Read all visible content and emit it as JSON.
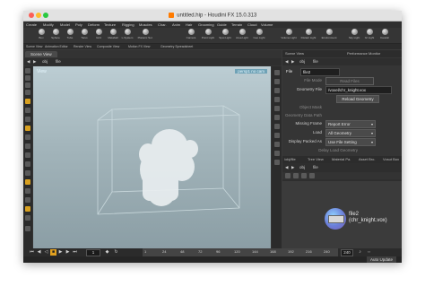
{
  "window": {
    "title": "untitled.hip - Houdini FX 15.0.313"
  },
  "menu": [
    "Create",
    "Modify",
    "Model",
    "Poly",
    "Deform",
    "Texture",
    "Rigging",
    "Muscles",
    "Char.",
    "Anim",
    "Hair",
    "Grooming",
    "Guide",
    "Terrain",
    "Cloud",
    "Volume"
  ],
  "toolbar": [
    "Box",
    "Sphere",
    "Tube",
    "Torus",
    "Grid",
    "Metaball",
    "L-System",
    "Platonic Sol.",
    "Camera",
    "Point Light",
    "Spot Light",
    "Area Light",
    "Geo Light",
    "Volume Light",
    "Distant Light",
    "Environment",
    "Sky Light",
    "GI Light",
    "Caustic"
  ],
  "subtabs": [
    "Scene View",
    "Animation Editor",
    "Render View",
    "Composite View",
    "Motion FX View",
    "Geometry Spreadsheet"
  ],
  "viewport": {
    "tab": "Scene View",
    "path": [
      "obj",
      "file"
    ],
    "label": "View",
    "badge": "persp1  no cam"
  },
  "params": {
    "tabs": [
      "Scene View",
      "Performance Monitor"
    ],
    "header": {
      "node_type": "File",
      "node_name": "file2"
    },
    "rows": [
      {
        "label": "File Mode",
        "value": "Read Files",
        "kind": "field",
        "dim": true
      },
      {
        "label": "Geometry File",
        "value": "/voxel/chr_knight.vox",
        "kind": "field",
        "dim": false
      },
      {
        "label": "",
        "value": "Reload Geometry",
        "kind": "button",
        "dim": false
      },
      {
        "label": "Object Mask",
        "value": "",
        "kind": "field",
        "dim": true
      },
      {
        "label": "Geometry Data Path",
        "value": "",
        "kind": "field",
        "dim": true
      },
      {
        "label": "Missing Frame",
        "value": "Report Error",
        "kind": "drop",
        "dim": false
      },
      {
        "label": "Load",
        "value": "All Geometry",
        "kind": "drop",
        "dim": false
      },
      {
        "label": "Display Packed As",
        "value": "Use File Setting",
        "kind": "drop",
        "dim": false
      },
      {
        "label": "",
        "value": "Delay Load Geometry",
        "kind": "field",
        "dim": true
      }
    ]
  },
  "network": {
    "tabs": [
      "/obj/file",
      "Tree View",
      "Material Pa.",
      "Asset Bro.",
      "Vcsut Box"
    ],
    "path": [
      "obj",
      "file"
    ],
    "node": {
      "name": "file2",
      "file": "(chr_knight.vox)"
    }
  },
  "playbar": {
    "frame": "1",
    "ticks": [
      "1",
      "24",
      "48",
      "72",
      "96",
      "120",
      "144",
      "168",
      "192",
      "216",
      "240"
    ],
    "end_frame": "240",
    "status": "Auto Update"
  }
}
